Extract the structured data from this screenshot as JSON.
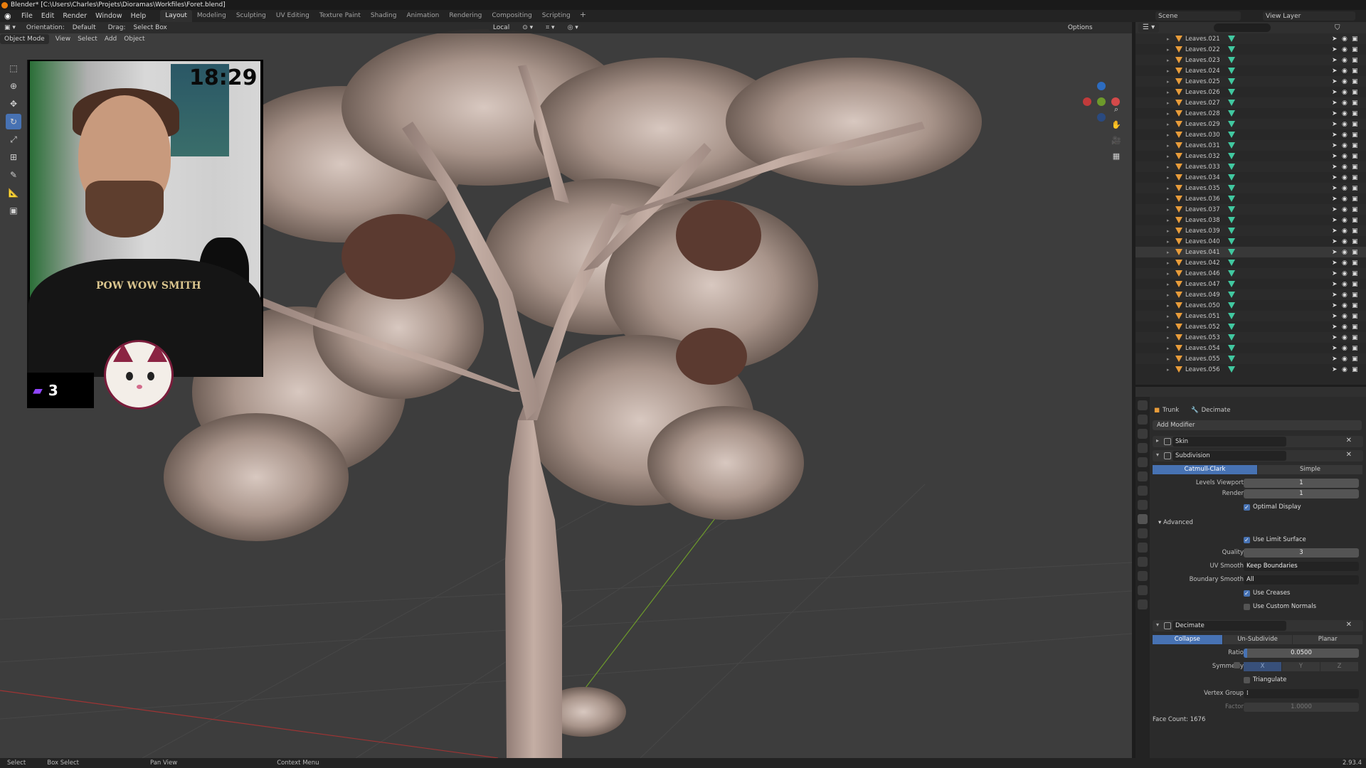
{
  "window": {
    "title": "Blender* [C:\\Users\\Charles\\Projets\\Dioramas\\Workfiles\\Foret.blend]"
  },
  "menu": [
    "File",
    "Edit",
    "Render",
    "Window",
    "Help"
  ],
  "workspaces": [
    "Layout",
    "Modeling",
    "Sculpting",
    "UV Editing",
    "Texture Paint",
    "Shading",
    "Animation",
    "Rendering",
    "Compositing",
    "Scripting"
  ],
  "active_workspace": "Layout",
  "scene": "Scene",
  "view_layer": "View Layer",
  "viewport": {
    "orientation_label": "Orientation:",
    "orientation": "Default",
    "drag_label": "Drag:",
    "drag": "Select Box",
    "transform": "Local",
    "options": "Options",
    "mode": "Object Mode",
    "view_menu": [
      "View",
      "Select",
      "Add",
      "Object"
    ]
  },
  "overlay": {
    "clock": "18:29",
    "viewer_count": "3",
    "shirt_text": "POW WOW SMITH"
  },
  "outliner": {
    "items": [
      "Leaves.021",
      "Leaves.022",
      "Leaves.023",
      "Leaves.024",
      "Leaves.025",
      "Leaves.026",
      "Leaves.027",
      "Leaves.028",
      "Leaves.029",
      "Leaves.030",
      "Leaves.031",
      "Leaves.032",
      "Leaves.033",
      "Leaves.034",
      "Leaves.035",
      "Leaves.036",
      "Leaves.037",
      "Leaves.038",
      "Leaves.039",
      "Leaves.040",
      "Leaves.041",
      "Leaves.042",
      "Leaves.046",
      "Leaves.047",
      "Leaves.049",
      "Leaves.050",
      "Leaves.051",
      "Leaves.052",
      "Leaves.053",
      "Leaves.054",
      "Leaves.055",
      "Leaves.056"
    ]
  },
  "properties": {
    "object": "Trunk",
    "modifier_crumb": "Decimate",
    "add_modifier": "Add Modifier",
    "skin": {
      "name": "Skin"
    },
    "subdivision": {
      "name": "Subdivision",
      "type_options": [
        "Catmull-Clark",
        "Simple"
      ],
      "levels_viewport_label": "Levels Viewport",
      "levels_viewport": "1",
      "render_label": "Render",
      "render": "1",
      "optimal_display": "Optimal Display",
      "advanced": "Advanced",
      "use_limit_surface": "Use Limit Surface",
      "quality_label": "Quality",
      "quality": "3",
      "uv_smooth_label": "UV Smooth",
      "uv_smooth": "Keep Boundaries",
      "boundary_smooth_label": "Boundary Smooth",
      "boundary_smooth": "All",
      "use_creases": "Use Creases",
      "use_custom_normals": "Use Custom Normals"
    },
    "decimate": {
      "name": "Decimate",
      "type_options": [
        "Collapse",
        "Un-Subdivide",
        "Planar"
      ],
      "ratio_label": "Ratio",
      "ratio": "0.0500",
      "symmetry_label": "Symmetry",
      "axes": [
        "X",
        "Y",
        "Z"
      ],
      "triangulate": "Triangulate",
      "vertex_group_label": "Vertex Group",
      "factor_label": "Factor",
      "factor": "1.0000",
      "face_count": "Face Count: 1676"
    }
  },
  "statusbar": {
    "items": [
      "Select",
      "Box Select",
      "Pan View",
      "Context Menu"
    ],
    "version": "2.93.4"
  },
  "colors": {
    "accent": "#4772b3",
    "object_icon": "#e89c3a",
    "mesh_icon": "#41c8a0",
    "viewport_bg": "#3d3d3d",
    "x_axis": "#c13b3b",
    "y_axis": "#6d9a2b"
  }
}
